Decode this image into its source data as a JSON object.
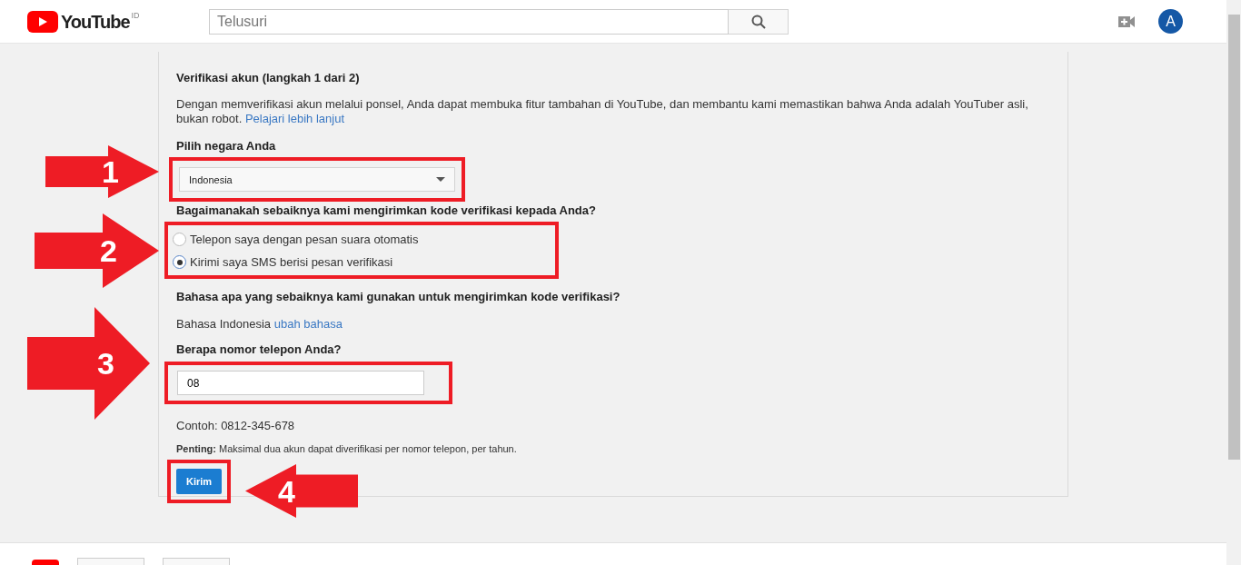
{
  "header": {
    "logo": "YouTube",
    "region": "ID",
    "search": {
      "placeholder": "Telusuri"
    },
    "avatar": "A"
  },
  "form": {
    "title": "Verifikasi akun (langkah 1 dari 2)",
    "intro": "Dengan memverifikasi akun melalui ponsel, Anda dapat membuka fitur tambahan di YouTube, dan membantu kami memastikan bahwa Anda adalah YouTuber asli, bukan robot.",
    "learn_more_link": "Pelajari lebih lanjut",
    "country_label": "Pilih negara Anda",
    "country": "Indonesia",
    "method_label": "Bagaimanakah sebaiknya kami mengirimkan kode verifikasi kepada Anda?",
    "methods": [
      {
        "label": "Telepon saya dengan pesan suara otomatis",
        "selected": false
      },
      {
        "label": "Kirimi saya SMS berisi pesan verifikasi",
        "selected": true
      }
    ],
    "language_label": "Bahasa apa yang sebaiknya kami gunakan untuk mengirimkan kode verifikasi?",
    "language": "Bahasa Indonesia",
    "change_language_link": "ubah bahasa",
    "phone_label": "Berapa nomor telepon Anda?",
    "phone_value": "08",
    "example": "Contoh: 0812-345-678",
    "note": "**Penting:** Maksimal dua akun dapat diverifikasi per nomor telepon, per tahun.",
    "submit": "Kirim"
  },
  "annotations": [
    {
      "number": "1",
      "kind": "right"
    },
    {
      "number": "2",
      "kind": "right"
    },
    {
      "number": "3",
      "kind": "right"
    },
    {
      "number": "4",
      "kind": "left"
    }
  ]
}
